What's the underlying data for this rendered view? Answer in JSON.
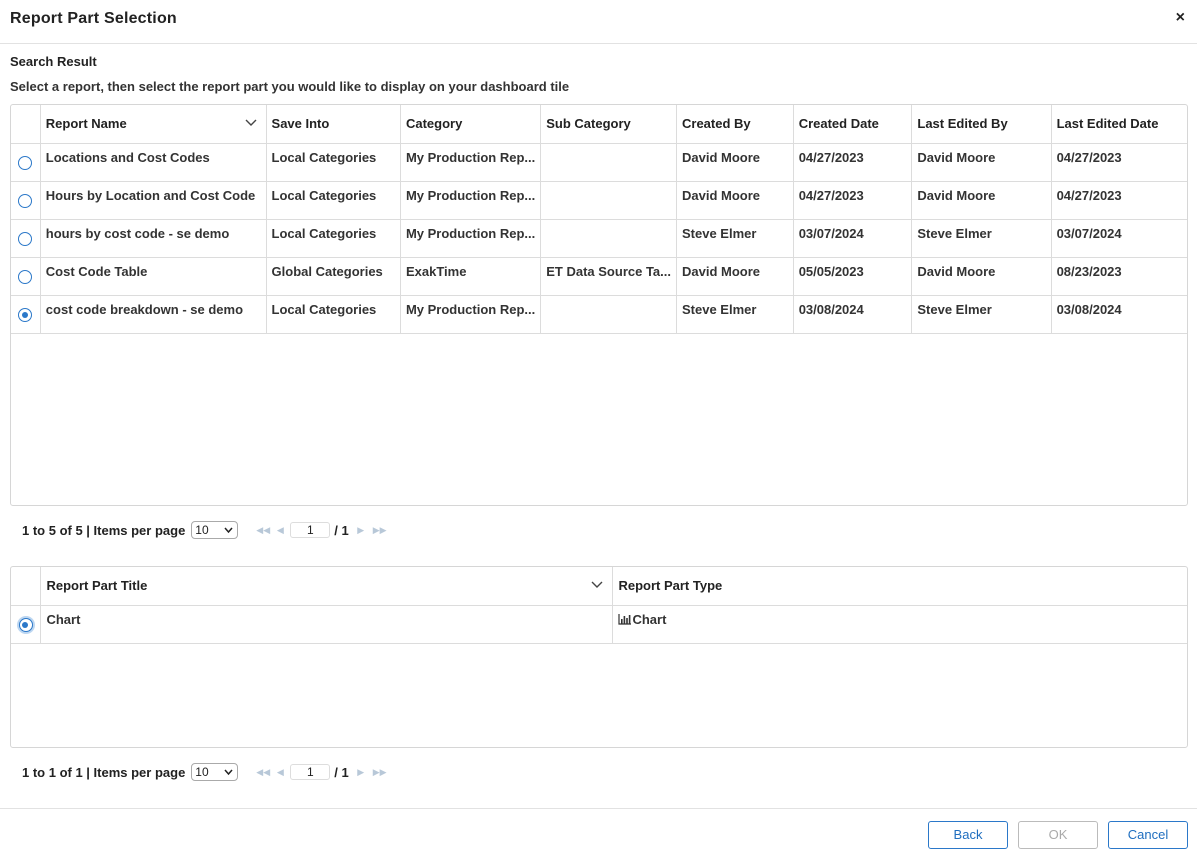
{
  "dialog": {
    "title": "Report Part Selection",
    "close_glyph": "×"
  },
  "search": {
    "section_title": "Search Result",
    "instructions": "Select a report, then select the report part you would like to display on your dashboard tile"
  },
  "reports_grid": {
    "columns": [
      "Report Name",
      "Save Into",
      "Category",
      "Sub Category",
      "Created By",
      "Created Date",
      "Last Edited By",
      "Last Edited Date"
    ],
    "rows": [
      {
        "selected": false,
        "name": "Locations and Cost Codes",
        "save_into": "Local Categories",
        "category": "My Production Rep...",
        "sub_category": "",
        "created_by": "David Moore",
        "created_date": "04/27/2023",
        "last_edited_by": "David Moore",
        "last_edited_date": "04/27/2023"
      },
      {
        "selected": false,
        "name": "Hours by Location and Cost Code",
        "save_into": "Local Categories",
        "category": "My Production Rep...",
        "sub_category": "",
        "created_by": "David Moore",
        "created_date": "04/27/2023",
        "last_edited_by": "David Moore",
        "last_edited_date": "04/27/2023"
      },
      {
        "selected": false,
        "name": "hours by cost code - se demo",
        "save_into": "Local Categories",
        "category": "My Production Rep...",
        "sub_category": "",
        "created_by": "Steve Elmer",
        "created_date": "03/07/2024",
        "last_edited_by": "Steve Elmer",
        "last_edited_date": "03/07/2024"
      },
      {
        "selected": false,
        "name": "Cost Code Table",
        "save_into": "Global Categories",
        "category": "ExakTime",
        "sub_category": "ET Data Source Ta...",
        "created_by": "David Moore",
        "created_date": "05/05/2023",
        "last_edited_by": "David Moore",
        "last_edited_date": "08/23/2023"
      },
      {
        "selected": true,
        "name": "cost code breakdown - se demo",
        "save_into": "Local Categories",
        "category": "My Production Rep...",
        "sub_category": "",
        "created_by": "Steve Elmer",
        "created_date": "03/08/2024",
        "last_edited_by": "Steve Elmer",
        "last_edited_date": "03/08/2024"
      }
    ],
    "pager": {
      "summary": "1 to 5 of 5 | Items per page",
      "page_size": "10",
      "page": "1",
      "total_pages": "/ 1"
    }
  },
  "parts_grid": {
    "columns": [
      "Report Part Title",
      "Report Part Type"
    ],
    "rows": [
      {
        "selected": true,
        "title": "Chart",
        "type": "Chart",
        "type_icon": "bar-chart-icon"
      }
    ],
    "pager": {
      "summary": "1 to 1 of 1 | Items per page",
      "page_size": "10",
      "page": "1",
      "total_pages": "/ 1"
    }
  },
  "footer": {
    "back_label": "Back",
    "ok_label": "OK",
    "cancel_label": "Cancel"
  },
  "colors": {
    "accent": "#2b78c9",
    "border": "#d6d6d6"
  }
}
